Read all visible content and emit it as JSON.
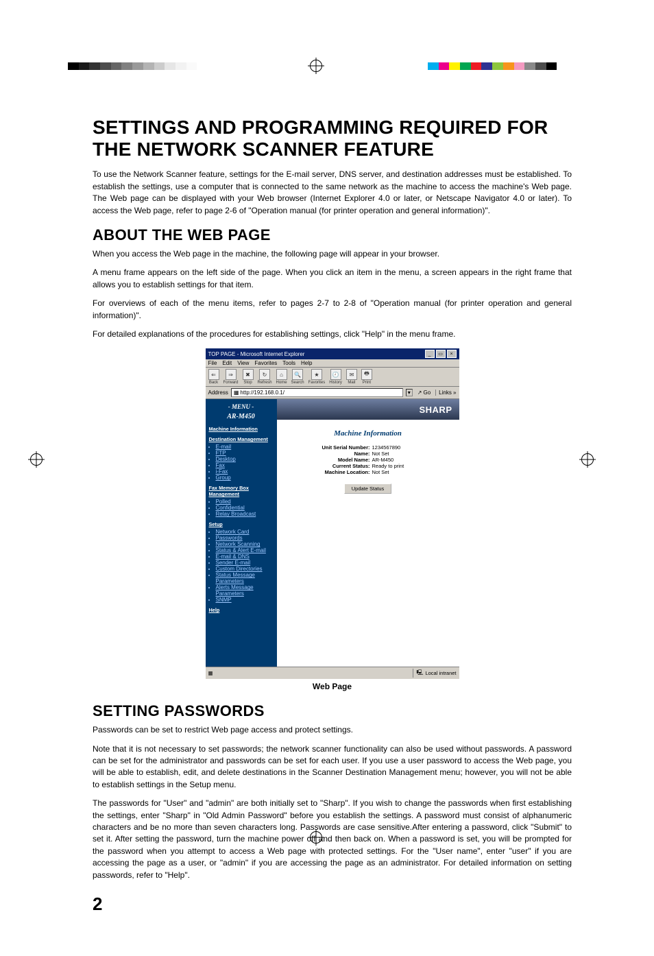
{
  "page_number": "2",
  "main_title": "SETTINGS AND PROGRAMMING REQUIRED FOR THE NETWORK SCANNER FEATURE",
  "intro_para": "To use the Network Scanner feature, settings for the E-mail server, DNS server, and destination addresses must be established. To establish the settings, use a computer that is connected to the same network as the machine to access the machine's Web page. The Web page can be displayed with your Web browser (Internet Explorer 4.0 or later, or Netscape Navigator 4.0 or later). To access the Web page, refer to page 2-6 of \"Operation manual (for printer operation and general information)\".",
  "about_heading": "ABOUT THE WEB PAGE",
  "about_paras": [
    "When you access the Web page in the machine, the following page will appear in your browser.",
    "A menu frame appears on the left side of the page. When you click an item in the menu, a screen appears in the right frame that allows you to establish settings for that item.",
    "For overviews of each of the menu items, refer to pages 2-7 to 2-8 of \"Operation manual (for printer operation and general information)\".",
    "For detailed explanations of the procedures for establishing settings, click \"Help\" in the menu frame."
  ],
  "screenshot_caption": "Web Page",
  "browser": {
    "title": "TOP PAGE - Microsoft Internet Explorer",
    "menus": [
      "File",
      "Edit",
      "View",
      "Favorites",
      "Tools",
      "Help"
    ],
    "toolbar": [
      "Back",
      "Forward",
      "Stop",
      "Refresh",
      "Home",
      "Search",
      "Favorites",
      "History",
      "Mail",
      "Print"
    ],
    "address_label": "Address",
    "address_value": "http://192.168.0.1/",
    "go_label": "Go",
    "links_label": "Links »",
    "statusbar_zone": "Local intranet"
  },
  "menu_frame": {
    "header": "- MENU -",
    "model": "AR-M450",
    "machine_info": "Machine Information",
    "dest_mgmt": "Destination Management",
    "dest_items": [
      "E-mail",
      "FTP",
      "Desktop",
      "Fax",
      "i-Fax",
      "Group"
    ],
    "fax_mem": "Fax Memory Box Management",
    "fax_items": [
      "Polled",
      "Confidential",
      "Relay Broadcast"
    ],
    "setup": "Setup",
    "setup_items": [
      "Network Card",
      "Passwords",
      "Network Scanning",
      "Status & Alert E-mail",
      "E-mail & DNS",
      "Sender E-mail",
      "Custom Directories",
      "Status Message Parameters",
      "Alerts Message Parameters",
      "SNMP"
    ],
    "help": "Help"
  },
  "right_frame": {
    "brand": "SHARP",
    "title": "Machine Information",
    "rows": [
      {
        "label": "Unit Serial Number:",
        "value": "1234567890"
      },
      {
        "label": "Name:",
        "value": "Not Set"
      },
      {
        "label": "Model Name:",
        "value": "AR-M450"
      },
      {
        "label": "Current Status:",
        "value": "Ready to print"
      },
      {
        "label": "Machine Location:",
        "value": "Not Set"
      }
    ],
    "update_btn": "Update Status"
  },
  "passwords_heading": "SETTING PASSWORDS",
  "passwords_paras": [
    "Passwords can be set to restrict Web page access and protect settings.",
    "Note that it is not necessary to set passwords; the network scanner functionality can also be used without passwords. A password can be set for the administrator and passwords can be set for each user. If you use a user password to access the Web page, you will be able to establish, edit, and delete destinations in the Scanner Destination Management menu; however, you will not be able to establish settings in the Setup menu.",
    "The passwords for \"User\" and \"admin\" are both initially set to \"Sharp\". If you wish to change the passwords when first establishing the settings, enter \"Sharp\" in \"Old Admin Password\" before you establish the settings. A password must consist of alphanumeric characters and be no more than seven characters long. Passwords are case sensitive.After entering a password, click \"Submit\" to set it. After setting the password, turn the machine power off and then back on. When a password is set, you will be prompted for the password when you attempt to access a Web page with protected settings. For the \"User name\", enter \"user\" if you are accessing the page as a user, or \"admin\" if you are accessing the page as an administrator. For detailed information on setting passwords, refer to \"Help\"."
  ],
  "colorbars": {
    "left": [
      "#000",
      "#1a1a1a",
      "#333",
      "#4d4d4d",
      "#666",
      "#808080",
      "#999",
      "#b3b3b3",
      "#ccc",
      "#e6e6e6",
      "#f2f2f2",
      "#fafafa",
      "#fff"
    ],
    "right": [
      "#00aeef",
      "#ec008c",
      "#fff200",
      "#00a651",
      "#ed1c24",
      "#2e3192",
      "#8dc63e",
      "#f7941d",
      "#f49ac1",
      "#898989",
      "#4d4d4d",
      "#000"
    ]
  }
}
